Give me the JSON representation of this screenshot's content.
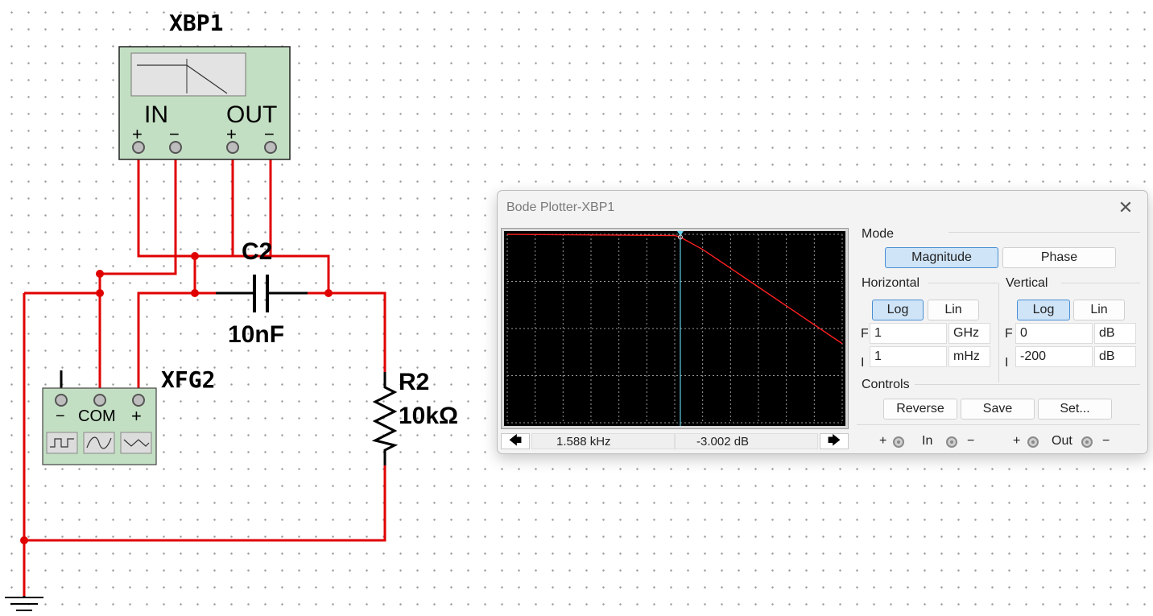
{
  "schematic": {
    "xbp_ref": "XBP1",
    "xbp_in": "IN",
    "xbp_out": "OUT",
    "plus": "+",
    "minus": "−",
    "cap_ref": "C2",
    "cap_value": "10nF",
    "res_ref": "R2",
    "res_value": "10kΩ",
    "fg_ref": "XFG2",
    "fg_com": "COM",
    "wire_color": "#e00000"
  },
  "bode": {
    "title": "Bode Plotter-XBP1",
    "close_icon": "close-icon",
    "mode_label": "Mode",
    "magnitude": "Magnitude",
    "phase": "Phase",
    "horizontal_label": "Horizontal",
    "vertical_label": "Vertical",
    "log": "Log",
    "lin": "Lin",
    "f_letter": "F",
    "i_letter": "I",
    "h_f_value": "1",
    "h_f_unit": "GHz",
    "h_i_value": "1",
    "h_i_unit": "mHz",
    "v_f_value": "0",
    "v_f_unit": "dB",
    "v_i_value": "-200",
    "v_i_unit": "dB",
    "controls_label": "Controls",
    "reverse": "Reverse",
    "save": "Save",
    "set": "Set...",
    "left_arrow": "🡄",
    "right_arrow": "🡆",
    "freq_readout": "1.588 kHz",
    "mag_readout": "-3.002 dB",
    "in_label": "In",
    "out_label": "Out",
    "term_plus": "+",
    "term_minus": "−",
    "accent": "#4a8fd4"
  },
  "chart_data": {
    "type": "line",
    "x_scale": "log",
    "xlim_hz": [
      0.001,
      1000000000
    ],
    "ylim_db": [
      -200,
      0
    ],
    "grid": true,
    "cursor_x_hz": 1588,
    "series": [
      {
        "color": "#ff2020",
        "x": [
          0.001,
          1000,
          1588,
          10000,
          100000,
          1000000,
          10000000,
          100000000,
          1000000000
        ],
        "y": [
          0,
          -1.3,
          -3.0,
          -16.1,
          -36,
          -56,
          -76,
          -96,
          -116
        ]
      }
    ]
  }
}
